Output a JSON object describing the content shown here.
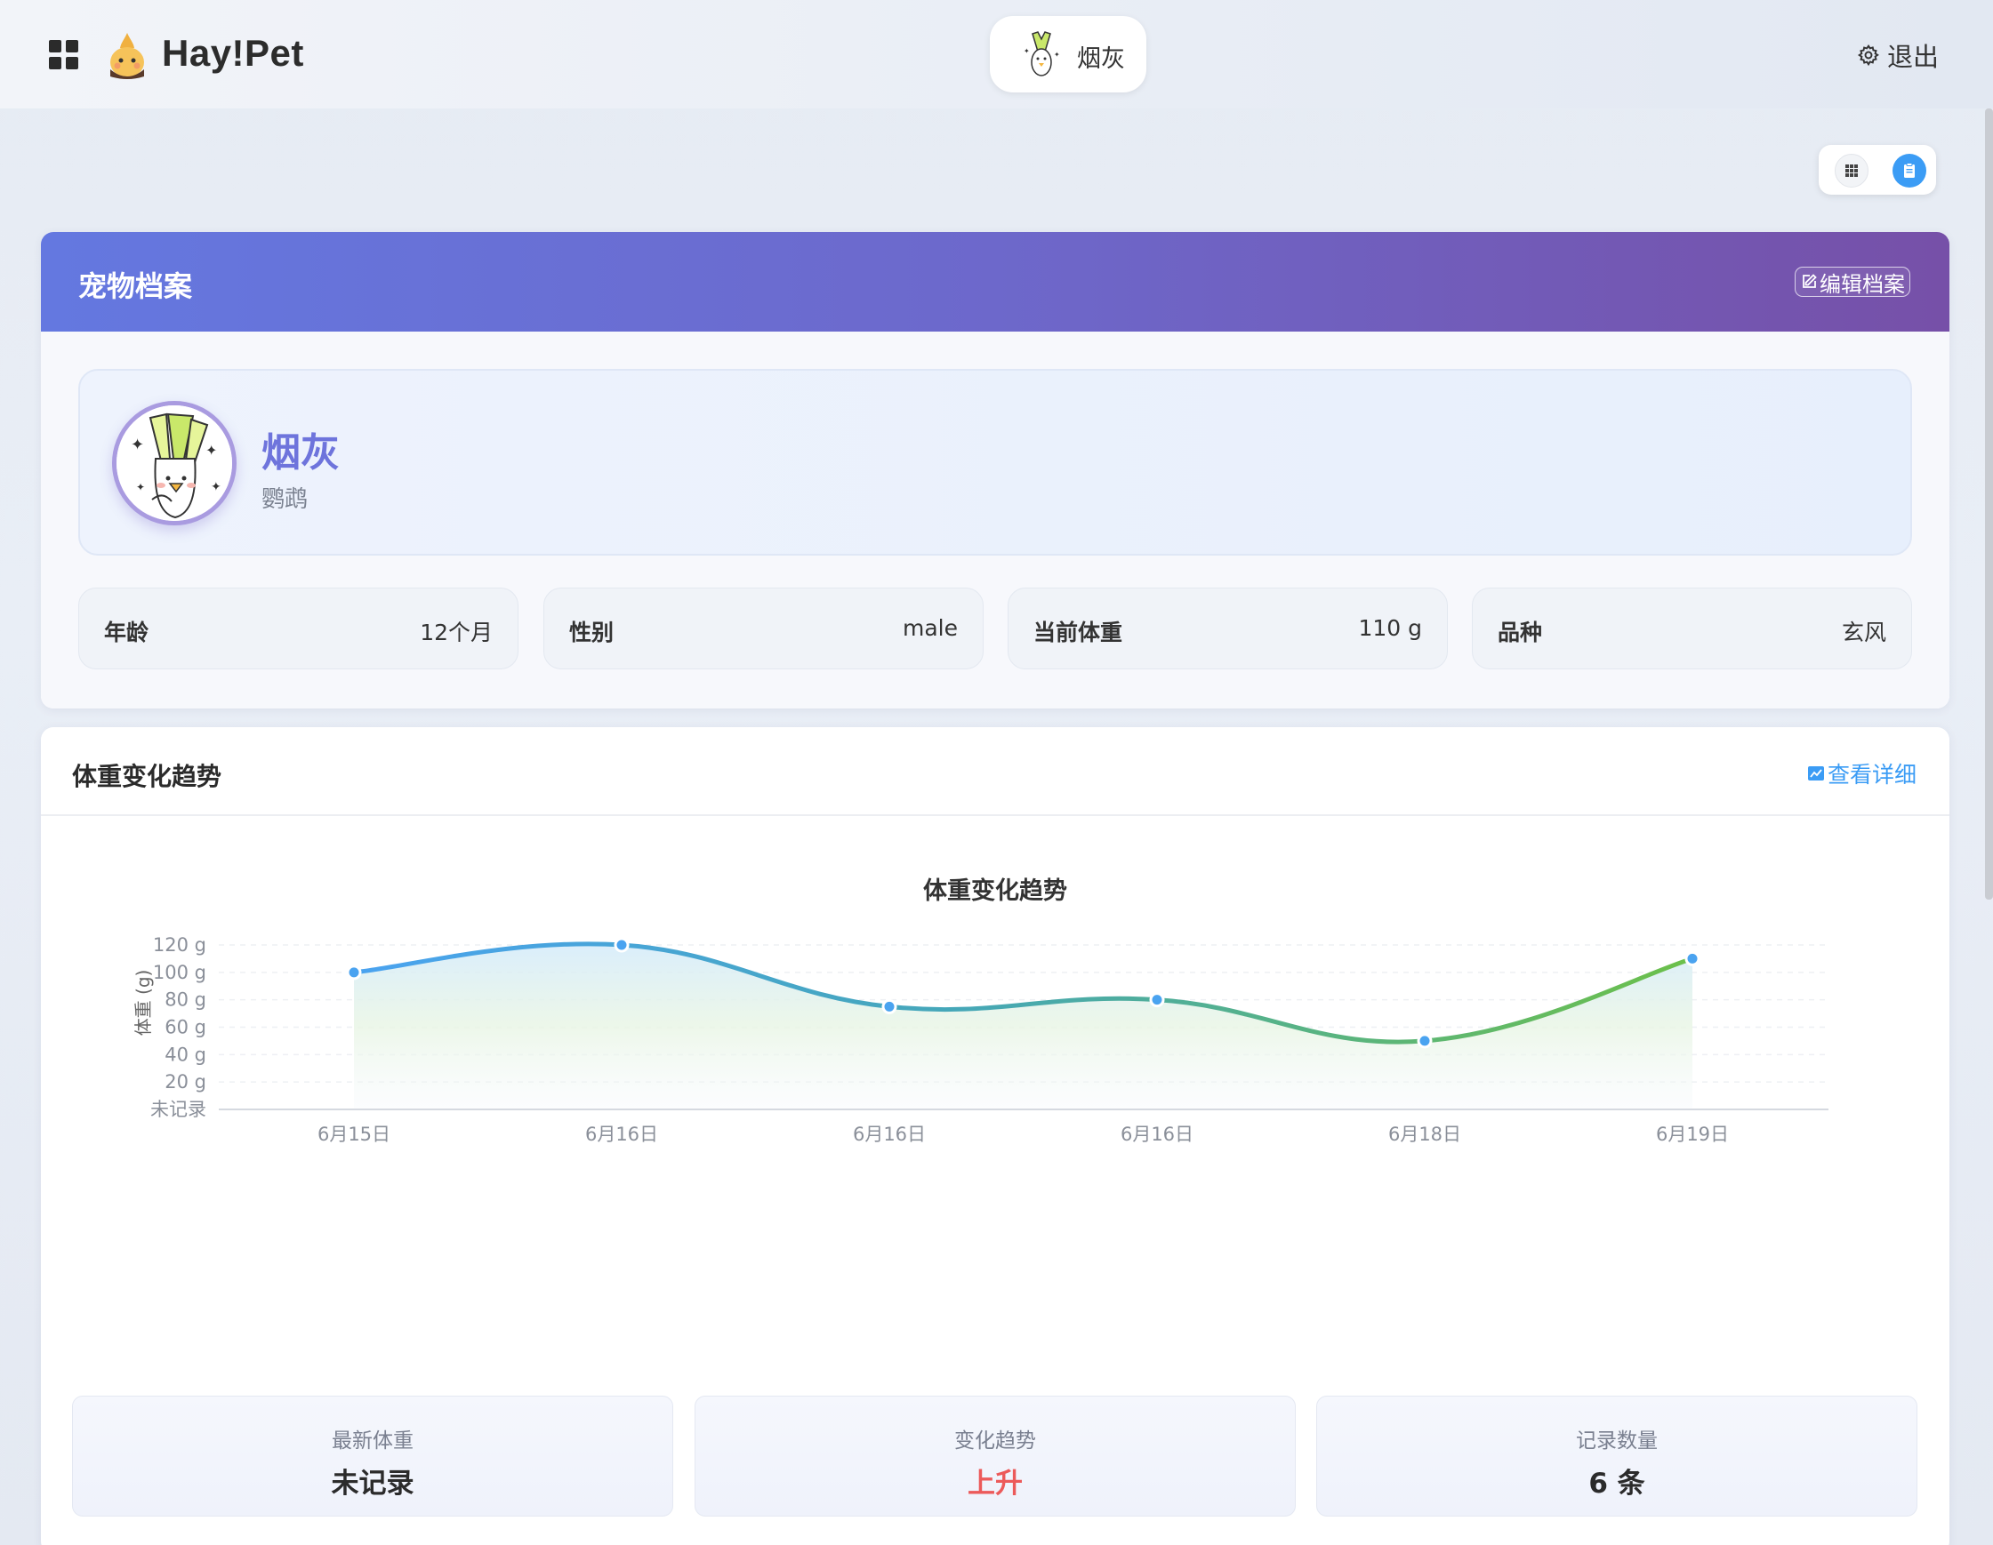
{
  "header": {
    "brand": "Hay!Pet",
    "current_pet": "烟灰",
    "logout_label": "退出"
  },
  "profile": {
    "title": "宠物档案",
    "edit_label": "编辑档案",
    "name": "烟灰",
    "species": "鹦鹉",
    "info": [
      {
        "key": "年龄",
        "value": "12个月"
      },
      {
        "key": "性别",
        "value": "male"
      },
      {
        "key": "当前体重",
        "value": "110 g"
      },
      {
        "key": "品种",
        "value": "玄风"
      }
    ]
  },
  "weight_section": {
    "title": "体重变化趋势",
    "detail_label": "查看详细"
  },
  "chart_data": {
    "type": "area",
    "title": "体重变化趋势",
    "ylabel": "体重 (g)",
    "xlabel": "",
    "categories": [
      "6月15日",
      "6月16日",
      "6月16日",
      "6月16日",
      "6月18日",
      "6月19日"
    ],
    "series": [
      {
        "values": [
          100,
          120,
          75,
          80,
          50,
          110
        ]
      }
    ],
    "ylim": [
      0,
      120
    ],
    "yticks": [
      "未记录",
      "20 g",
      "40 g",
      "60 g",
      "80 g",
      "100 g",
      "120 g"
    ],
    "grid": true,
    "colors": {
      "start": "#4aa3f0",
      "end": "#6cc04a"
    }
  },
  "stats": [
    {
      "label": "最新体重",
      "value": "未记录",
      "color": "#2b2b2b"
    },
    {
      "label": "变化趋势",
      "value": "上升",
      "color": "#ec5a5a"
    },
    {
      "label": "记录数量",
      "value": "6 条",
      "color": "#2b2b2b"
    }
  ],
  "icons": {
    "menu": "grid-icon",
    "logo": "bird-logo-icon",
    "settings": "gear-icon",
    "edit": "edit-icon",
    "chart": "chart-icon"
  }
}
